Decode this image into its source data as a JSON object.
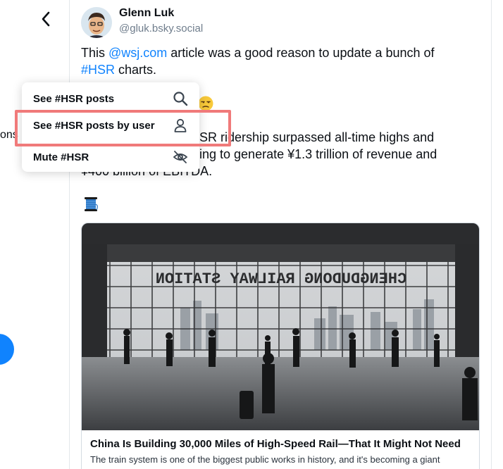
{
  "nav": {
    "back_icon": "chevron-left-icon"
  },
  "background": {
    "left_fragment_text": "ons"
  },
  "post": {
    "author_name": "Glenn Luk",
    "author_handle": "@gluk.bsky.social",
    "line1_prefix": "This ",
    "line1_link": "@wsj.com",
    "line1_suffix": " article was a good reason to update a bunch of",
    "line2_link": "#HSR",
    "line2_suffix": " charts.",
    "para2_line1": "SR ridership surpassed all-time highs and",
    "para2_line2": "ing to generate ¥1.3 trillion of revenue and",
    "para2_line3": "¥400 billion of EBITDA.",
    "thread_emoji": "spool-of-thread-icon",
    "sad_emoji": "unamused-face-icon"
  },
  "link_card": {
    "image_sign_text": "CHENGDUDONG RAILWAY STATION",
    "title": "China Is Building 30,000 Miles of High-Speed Rail—That It Might Not Need",
    "description": "The train system is one of the biggest public works in history, and it's becoming a giant"
  },
  "context_menu": {
    "items": [
      {
        "label": "See #HSR posts",
        "icon": "search-icon"
      },
      {
        "label": "See #HSR posts by user",
        "icon": "person-icon"
      },
      {
        "label": "Mute #HSR",
        "icon": "eye-slash-icon"
      }
    ]
  },
  "colors": {
    "link": "#1083fe",
    "highlight": "#f07a7a",
    "text": "#0b0f14",
    "muted": "#6f7d8c"
  }
}
